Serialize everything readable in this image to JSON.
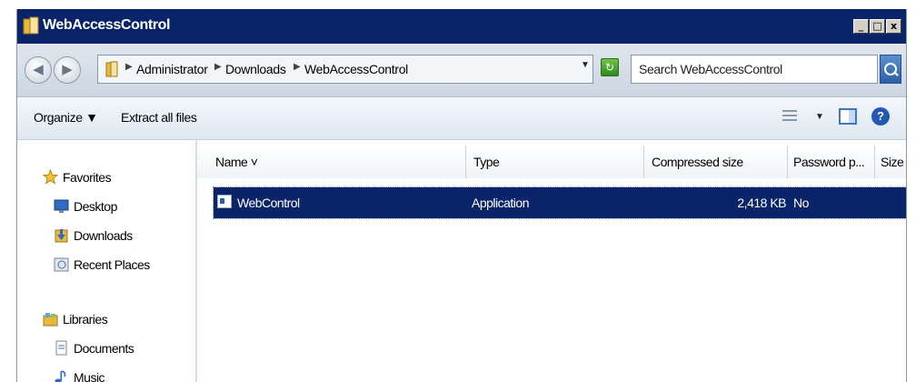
{
  "window": {
    "title": "WebAccessControl",
    "controls": {
      "minimize": "_",
      "maximize": "□",
      "close": "x"
    }
  },
  "address": {
    "breadcrumbs": [
      "Administrator",
      "Downloads",
      "WebAccessControl"
    ],
    "search_placeholder": "Search WebAccessControl"
  },
  "toolbar": {
    "organize_label": "Organize",
    "extract_label": "Extract all files",
    "help_label": "?"
  },
  "sidebar": {
    "favorites": {
      "label": "Favorites",
      "items": [
        "Desktop",
        "Downloads",
        "Recent Places"
      ]
    },
    "libraries": {
      "label": "Libraries",
      "items": [
        "Documents",
        "Music"
      ]
    }
  },
  "file_list": {
    "columns": [
      "Name",
      "Type",
      "Compressed size",
      "Password p...",
      "Size"
    ],
    "rows": [
      {
        "name": "WebControl",
        "type": "Application",
        "compressed_size": "2,418 KB",
        "password_protected": "No"
      }
    ]
  },
  "colors": {
    "titlebar": "#0a246a",
    "selection": "#0a246a",
    "folder": "#e8b93c"
  },
  "icons": [
    "folder-icon",
    "back-icon",
    "forward-icon",
    "refresh-icon",
    "search-icon",
    "view-options-icon",
    "preview-pane-icon",
    "help-icon",
    "star-icon",
    "desktop-icon",
    "downloads-icon",
    "recent-places-icon",
    "libraries-icon",
    "documents-icon",
    "music-icon",
    "application-icon"
  ]
}
